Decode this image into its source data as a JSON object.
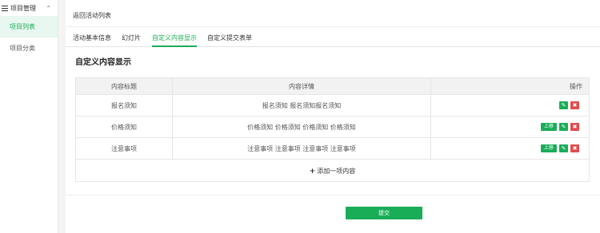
{
  "sidebar": {
    "header": "项目管理",
    "items": [
      {
        "label": "项目列表"
      },
      {
        "label": "项目分类"
      }
    ]
  },
  "main": {
    "back_link": "返回活动列表",
    "tabs": [
      {
        "label": "活动基本信息"
      },
      {
        "label": "幻灯片"
      },
      {
        "label": "自定义内容显示"
      },
      {
        "label": "自定义提交表单"
      }
    ],
    "section_title": "自定义内容显示",
    "table": {
      "headers": [
        "内容标题",
        "内容详情",
        "操作"
      ],
      "rows": [
        {
          "title": "报名须知",
          "detail": "报名须知 报名须知报名须知"
        },
        {
          "title": "价格须知",
          "detail": "价格须知 价格须知 价格须知 价格须知"
        },
        {
          "title": "注意事项",
          "detail": "注意事项 注意事项 注意事项 注意事项"
        }
      ],
      "move_up_label": "上移",
      "add_label": "添加一项内容"
    },
    "submit_label": "提交"
  },
  "colors": {
    "accent": "#1aad58",
    "danger": "#e24b4b"
  },
  "icons": {
    "sidebar_header": "list-menu-icon",
    "collapse": "chevron-up-icon",
    "edit": "edit-icon",
    "delete": "close-icon",
    "add": "plus-icon"
  }
}
